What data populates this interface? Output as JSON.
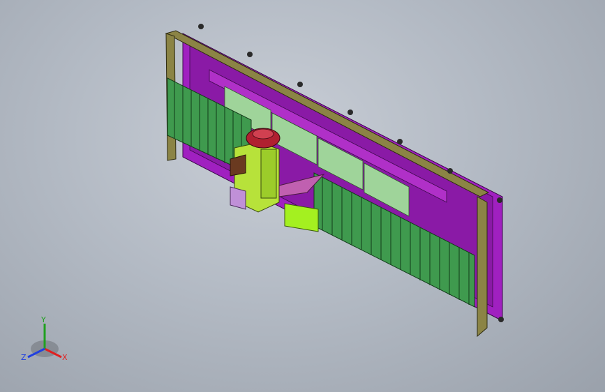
{
  "view": {
    "background_top": "#c9ced6",
    "background_bottom": "#9aa1ab"
  },
  "model": {
    "frame_color": "#a020c0",
    "outer_frame_color": "#8b8445",
    "panel_color": "#3f9a4e",
    "rail_color": "#9fd49a",
    "carriage_color": "#b7e23a",
    "motor_color": "#b02030",
    "bracket_color": "#c060b0"
  },
  "triad": {
    "x_label": "X",
    "y_label": "Y",
    "z_label": "Z",
    "x_color": "#e02020",
    "y_color": "#20a020",
    "z_color": "#2040e0"
  }
}
